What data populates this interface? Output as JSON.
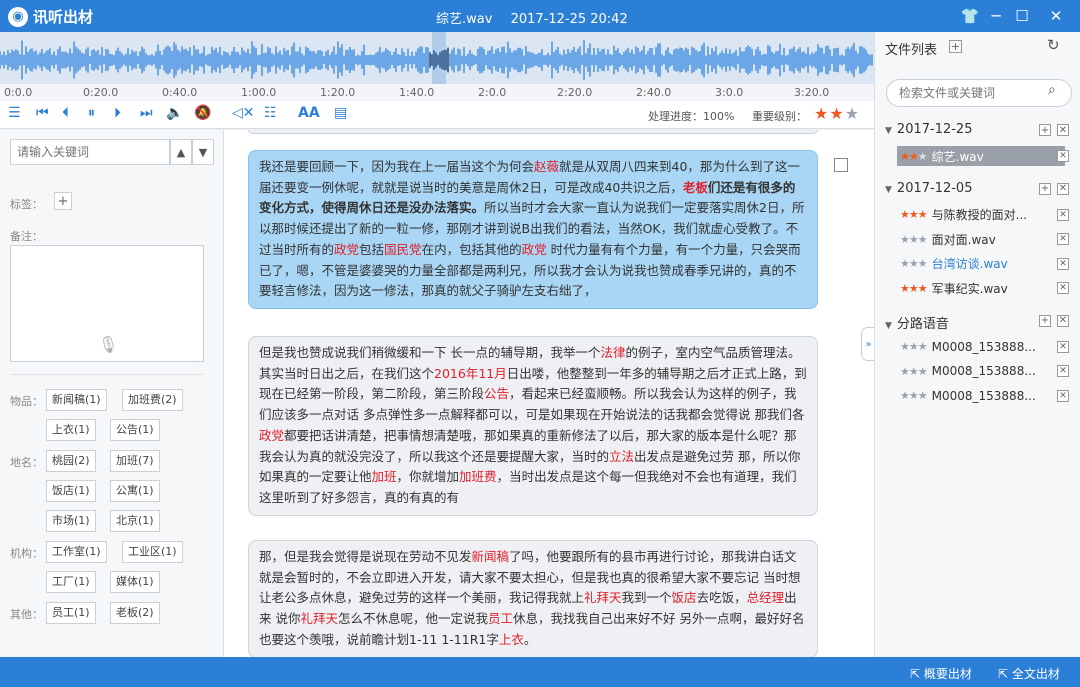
{
  "app": {
    "name": "讯听出材"
  },
  "window": {
    "filename": "综艺.wav",
    "datetime": "2017-12-25 20:42"
  },
  "timeline": [
    "0:0.0",
    "0:20.0",
    "0:40.0",
    "1:00.0",
    "1:20.0",
    "1:40.0",
    "2:0.0",
    "2:20.0",
    "2:40.0",
    "3:0.0",
    "3:20.0"
  ],
  "toolbar": {
    "progress_label": "处理进度：100%",
    "importance_label": "重要级别：",
    "importance_stars": 2
  },
  "left": {
    "keyword_placeholder": "请输入关键词",
    "tags_label": "标签：",
    "notes_label": "备注：",
    "categories": [
      {
        "label": "物品：",
        "chips": [
          "新闻稿(1)",
          "加班费(2)",
          "上衣(1)",
          "公告(1)"
        ]
      },
      {
        "label": "地名：",
        "chips": [
          "桃园(2)",
          "加班(7)",
          "饭店(1)",
          "公寓(1)",
          "市场(1)",
          "北京(1)"
        ]
      },
      {
        "label": "机构：",
        "chips": [
          "工作室(1)",
          "工业区(1)",
          "工厂(1)",
          "媒体(1)"
        ]
      },
      {
        "label": "其他：",
        "chips": [
          "员工(1)",
          "老板(2)"
        ]
      }
    ]
  },
  "transcript": [
    {
      "segments": [
        [
          "我还是要回顾一下，因为我在上一届当这个为何会",
          ""
        ],
        [
          "赵薇",
          "r"
        ],
        [
          "就是从双周八四来到40，那为什么到了这一届还要变一例休呢，就就是说当时的美意是周休2日，可是改成40共识之后，",
          ""
        ],
        [
          "老板",
          "rb"
        ],
        [
          "们还是有很多的变化方式，使得周休日还是没办法落实。",
          "b"
        ],
        [
          "所以当时才会大家一直认为说我们一定要落实周休2日，所以那时候还提出了新的一粒一修，那刚才讲到说B出我们的看法，当然OK，我们就虚心受教了。不过当时所有的",
          ""
        ],
        [
          "政党",
          "r"
        ],
        [
          "包括",
          ""
        ],
        [
          "国民党",
          "r"
        ],
        [
          "在内，包括其他的",
          ""
        ],
        [
          "政党",
          "r"
        ],
        [
          " 时代力量有有个力量，有一个力量，只会哭而已了，嗯，不管是婆婆哭的力量全部都是两利兄，所以我才会认为说我也赞成春季兄讲的，真的不要轻言修法，因为这一修法，那真的就父子骑驴左支右绌了，",
          ""
        ]
      ]
    },
    {
      "segments": [
        [
          "但是我也赞成说我们稍微缓和一下 长一点的辅导期，我举一个",
          ""
        ],
        [
          "法律",
          "r"
        ],
        [
          "的例子，室内空气品质管理法。其实当时日出之后，在我们这个",
          ""
        ],
        [
          "2016年11月",
          "r"
        ],
        [
          "日出喽，他整整到一年多的辅导期之后才正式上路，到现在已经第一阶段，第二阶段，第三阶段",
          ""
        ],
        [
          "公告",
          "r"
        ],
        [
          "，看起来已经蛮顺畅。所以我会认为这样的例子，我们应该多一点对话 多点弹性多一点解释都可以，可是如果现在开始说法的话我都会觉得说 那我们各",
          ""
        ],
        [
          "政党",
          "r"
        ],
        [
          "都要把话讲清楚，把事情想清楚哦，那如果真的重新修法了以后，那大家的版本是什么呢？那我会认为真的就没完没了，所以我这个还是要提醒大家，当时的",
          ""
        ],
        [
          "立法",
          "r"
        ],
        [
          "出发点是避免过劳 那，所以你如果真的一定要让他",
          ""
        ],
        [
          "加班",
          "r"
        ],
        [
          "，你就增加",
          ""
        ],
        [
          "加班费",
          "r"
        ],
        [
          "，当时出发点是这个每一但我绝对不会也有道理，我们这里听到了好多怨言，真的有真的有",
          ""
        ]
      ]
    },
    {
      "segments": [
        [
          "那，但是我会觉得是说现在劳动不见发",
          ""
        ],
        [
          "新闻稿",
          "r"
        ],
        [
          "了吗，他要跟所有的县市再进行讨论，那我讲白话文就是会暂时的，不会立即进入开发，请大家不要太担心，但是我也真的很希望大家不要忘记 当时想让老公多点休息，避免过劳的这样一个美丽，我记得我就上",
          ""
        ],
        [
          "礼拜天",
          "r"
        ],
        [
          "我到一个",
          ""
        ],
        [
          "饭店",
          "r"
        ],
        [
          "去吃饭，",
          ""
        ],
        [
          "总经理",
          "r"
        ],
        [
          "出来 说你",
          ""
        ],
        [
          "礼拜天",
          "r"
        ],
        [
          "怎么不休息呢，他一定说我",
          ""
        ],
        [
          "员工",
          "r"
        ],
        [
          "休息，我找我自己出来好不好 另外一点啊，最好好名也要这个羡哦，说前瞻计划1-11 1-11R1字",
          ""
        ],
        [
          "上衣",
          "r"
        ],
        [
          "。",
          ""
        ]
      ]
    }
  ],
  "right": {
    "title": "文件列表",
    "search_placeholder": "检索文件或关键词",
    "groups": [
      {
        "name": "2017-12-25",
        "files": [
          {
            "name": "综艺.wav",
            "stars": 2,
            "active": true,
            "blue": false
          }
        ]
      },
      {
        "name": "2017-12-05",
        "files": [
          {
            "name": "与陈教授的面对...",
            "stars": 3,
            "active": false,
            "blue": false
          },
          {
            "name": "面对面.wav",
            "stars": 0,
            "active": false,
            "blue": false
          },
          {
            "name": "台湾访谈.wav",
            "stars": 0,
            "active": false,
            "blue": true
          },
          {
            "name": "军事纪实.wav",
            "stars": 3,
            "active": false,
            "blue": false
          }
        ]
      },
      {
        "name": "分路语音",
        "files": [
          {
            "name": "M0008_153888...",
            "stars": 0,
            "active": false,
            "blue": false
          },
          {
            "name": "M0008_153888...",
            "stars": 0,
            "active": false,
            "blue": false
          },
          {
            "name": "M0008_153888...",
            "stars": 0,
            "active": false,
            "blue": false
          }
        ]
      }
    ]
  },
  "status": {
    "summary_export": "概要出材",
    "full_export": "全文出材"
  },
  "colors": {
    "accent": "#2b7fd6",
    "keyword": "#e0202a",
    "star": "#f05a22",
    "selected_bubble": "#a9d6f5"
  }
}
